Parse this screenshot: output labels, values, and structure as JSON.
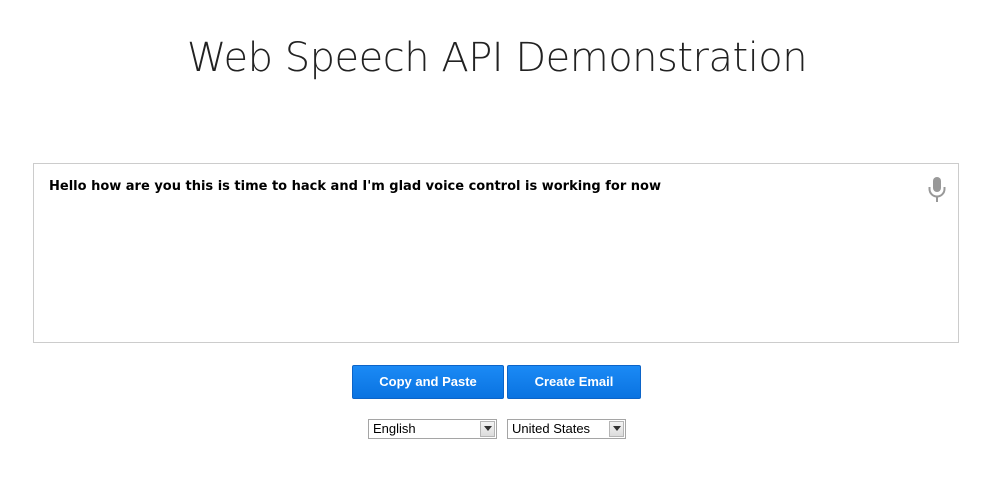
{
  "page": {
    "title_part1": "Web Speech API",
    "title_part2": "Demonstration"
  },
  "results": {
    "transcript": "Hello how are you this is time to hack and I'm glad voice control is working for now",
    "mic_icon": "microphone-icon"
  },
  "buttons": {
    "copy_label": "Copy and Paste",
    "email_label": "Create Email"
  },
  "selects": {
    "language": {
      "selected": "English",
      "icon": "chevron-down-icon"
    },
    "dialect": {
      "selected": "United States",
      "icon": "chevron-down-icon"
    }
  },
  "colors": {
    "button_bg": "#0a73e1",
    "button_text": "#ffffff",
    "mic_gray": "#999999",
    "border": "#cccccc"
  }
}
